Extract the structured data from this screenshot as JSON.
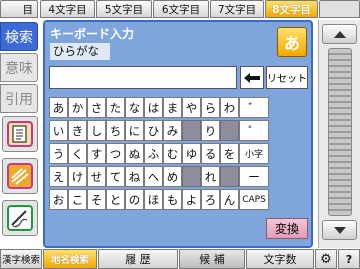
{
  "tabs": [
    {
      "label": "4文字目"
    },
    {
      "label": "5文字目"
    },
    {
      "label": "6文字目"
    },
    {
      "label": "7文字目"
    },
    {
      "label": "8文字目"
    }
  ],
  "tab_partial_left": "目",
  "sidebar": {
    "items": [
      {
        "label": "検索"
      },
      {
        "label": "意味"
      },
      {
        "label": "引用"
      }
    ]
  },
  "keyboard": {
    "title": "キーボード入力",
    "mode_label": "ひらがな",
    "input_value": "",
    "mode_button": "あ",
    "backspace_icon": "left-arrow-icon",
    "reset_button": "リセット",
    "convert_button": "変換",
    "rows": [
      [
        "あ",
        "か",
        "さ",
        "た",
        "な",
        "は",
        "ま",
        "や",
        "ら",
        "わ",
        "゛"
      ],
      [
        "い",
        "き",
        "し",
        "ち",
        "に",
        "ひ",
        "み",
        "",
        "り",
        "",
        "゜"
      ],
      [
        "う",
        "く",
        "す",
        "つ",
        "ぬ",
        "ふ",
        "む",
        "ゆ",
        "る",
        "を",
        "小字"
      ],
      [
        "え",
        "け",
        "せ",
        "て",
        "ね",
        "へ",
        "め",
        "",
        "れ",
        "",
        "ー"
      ],
      [
        "お",
        "こ",
        "そ",
        "と",
        "の",
        "ほ",
        "も",
        "よ",
        "ろ",
        "ん",
        "CAPS"
      ]
    ]
  },
  "bottom": {
    "search1": "漢字検索",
    "search2": "地名検索",
    "history": "履 歴",
    "candidates": "候 補",
    "char_count": "文字数",
    "settings_icon": "gear-icon",
    "help_symbol": "?"
  },
  "colors": {
    "accent_orange": "#f2a800",
    "selected_blue": "#3d6bd6",
    "panel_blue": "#7fa5dc",
    "blank_key": "#8d8d9e"
  }
}
